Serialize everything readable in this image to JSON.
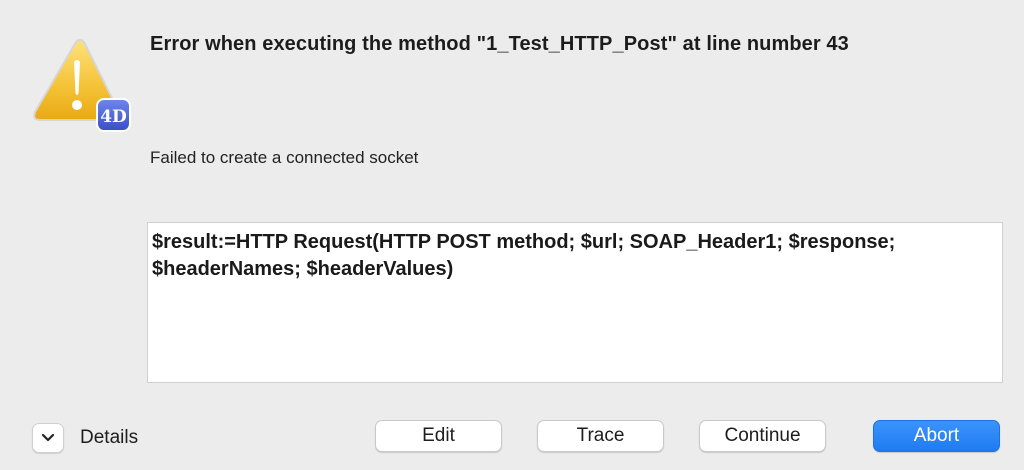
{
  "dialog": {
    "title": "Error when executing the method \"1_Test_HTTP_Post\" at line number 43",
    "message": "Failed to create a connected socket",
    "code": "$result:=HTTP Request(HTTP POST method; $url; SOAP_Header1; $response; $headerNames; $headerValues)",
    "icon": "warning-triangle-icon",
    "badge_icon": "4d-app-icon",
    "badge_text": "4D"
  },
  "footer": {
    "details_label": "Details",
    "buttons": {
      "edit": "Edit",
      "trace": "Trace",
      "continue": "Continue",
      "abort": "Abort"
    }
  },
  "colors": {
    "background": "#ececec",
    "warning_yellow": "#f2c230",
    "badge_blue": "#4a5fd0",
    "primary_button": "#2680f5"
  }
}
